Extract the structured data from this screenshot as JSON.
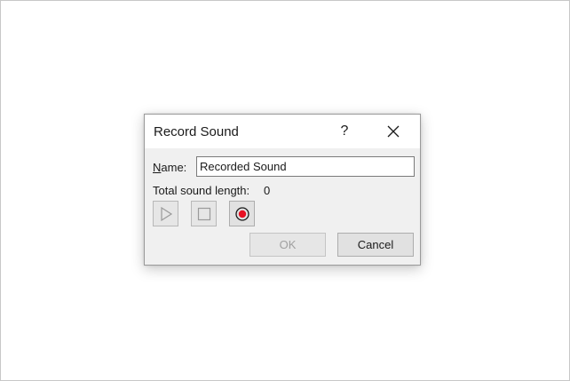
{
  "dialog": {
    "title": "Record Sound",
    "help_label": "?",
    "close_icon": "close-icon"
  },
  "name_field": {
    "label_mnemonic": "N",
    "label_rest": "ame:",
    "value": "Recorded Sound"
  },
  "sound_length": {
    "label": "Total sound length:",
    "value": "0"
  },
  "media_controls": {
    "play_icon": "play-icon",
    "stop_icon": "stop-icon",
    "record_icon": "record-icon",
    "record_color": "#e81123"
  },
  "buttons": {
    "ok_label": "OK",
    "cancel_label": "Cancel"
  }
}
